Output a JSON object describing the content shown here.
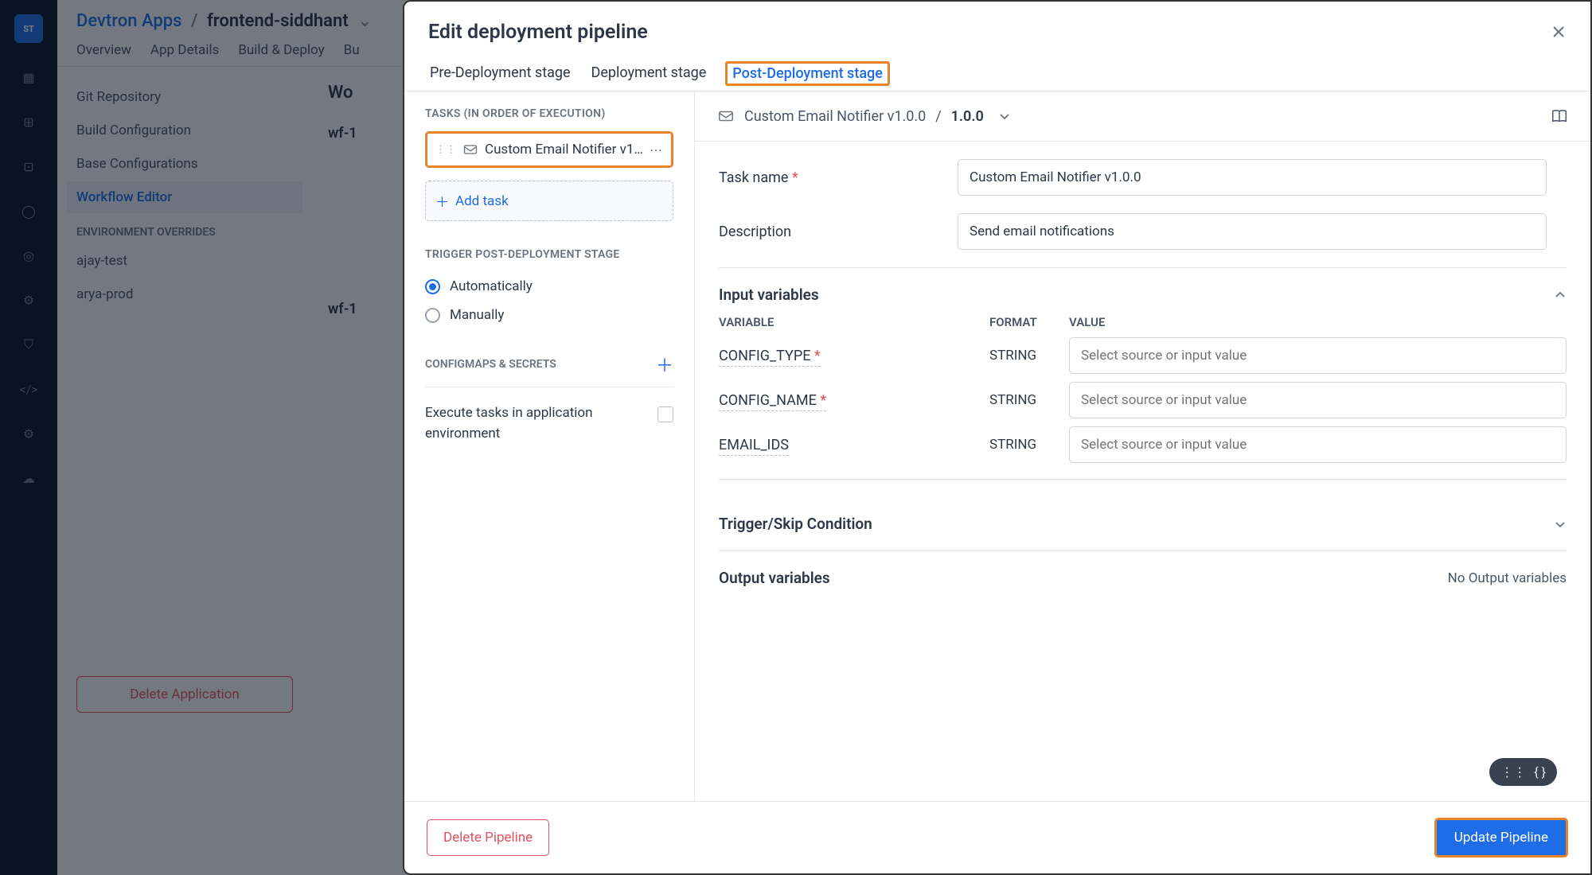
{
  "bg": {
    "logo": "ST",
    "breadcrumb": {
      "root": "Devtron Apps",
      "app": "frontend-siddhant"
    },
    "tabs": [
      "Overview",
      "App Details",
      "Build & Deploy",
      "Bu"
    ],
    "left_items": [
      "Git Repository",
      "Build Configuration",
      "Base Configurations",
      "Workflow Editor"
    ],
    "left_active_index": 3,
    "left_header": "ENVIRONMENT OVERRIDES",
    "envs": [
      "ajay-test",
      "arya-prod"
    ],
    "delete_app": "Delete Application",
    "center_h": "Wo",
    "wf1": "wf-1",
    "wf2": "wf-1"
  },
  "modal": {
    "title": "Edit deployment pipeline",
    "tabs": [
      "Pre-Deployment stage",
      "Deployment stage",
      "Post-Deployment stage"
    ],
    "active_tab_index": 2,
    "tasks_header": "TASKS (IN ORDER OF EXECUTION)",
    "task_name_trunc": "Custom Email Notifier v1.…",
    "add_task": "Add task",
    "trigger_header": "TRIGGER POST-DEPLOYMENT STAGE",
    "trigger_options": [
      "Automatically",
      "Manually"
    ],
    "trigger_selected_index": 0,
    "cm_header": "CONFIGMAPS & SECRETS",
    "exec_label": "Execute tasks in application environment",
    "crumb": {
      "name": "Custom Email Notifier v1.0.0",
      "version": "1.0.0"
    },
    "form": {
      "task_name_label": "Task name",
      "task_name_value": "Custom Email Notifier v1.0.0",
      "desc_label": "Description",
      "desc_value": "Send email notifications"
    },
    "ivars": {
      "header": "Input variables",
      "cols": {
        "variable": "VARIABLE",
        "format": "FORMAT",
        "value": "VALUE"
      },
      "rows": [
        {
          "name": "CONFIG_TYPE",
          "required": true,
          "format": "STRING",
          "placeholder": "Select source or input value"
        },
        {
          "name": "CONFIG_NAME",
          "required": true,
          "format": "STRING",
          "placeholder": "Select source or input value"
        },
        {
          "name": "EMAIL_IDS",
          "required": false,
          "format": "STRING",
          "placeholder": "Select source or input value"
        }
      ]
    },
    "trigger_skip": "Trigger/Skip Condition",
    "output_vars": "Output variables",
    "no_output": "No Output variables",
    "delete_pipeline": "Delete Pipeline",
    "update_pipeline": "Update Pipeline"
  }
}
